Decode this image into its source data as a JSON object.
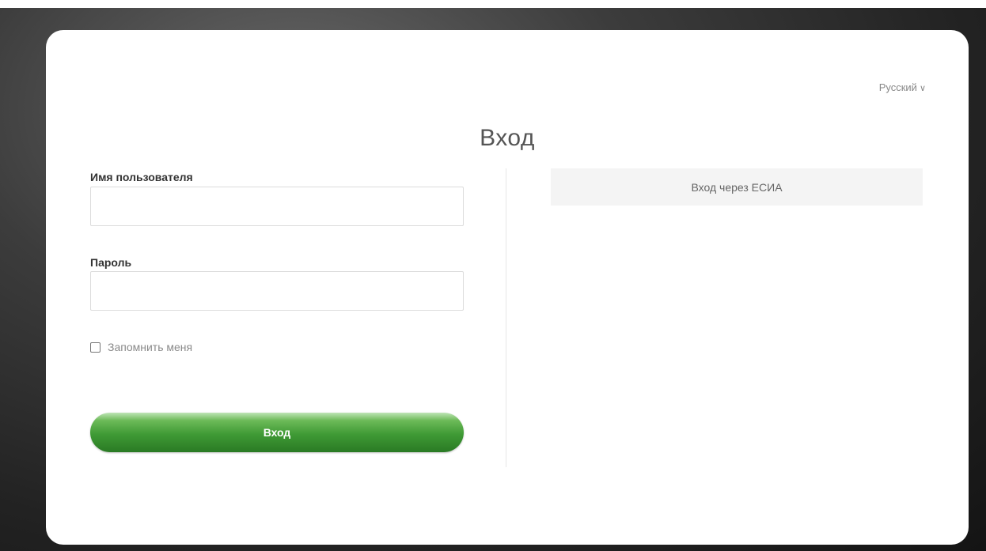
{
  "language": {
    "label": "Русский",
    "chevron": "∨"
  },
  "title": "Вход",
  "form": {
    "username_label": "Имя пользователя",
    "username_value": "",
    "password_label": "Пароль",
    "password_value": "",
    "remember_label": "Запомнить меня",
    "remember_checked": false,
    "submit_label": "Вход"
  },
  "esia": {
    "label": "Вход через ЕСИА"
  },
  "colors": {
    "accent": "#3f9a35",
    "background": "#2a2a2a",
    "card": "#ffffff"
  }
}
